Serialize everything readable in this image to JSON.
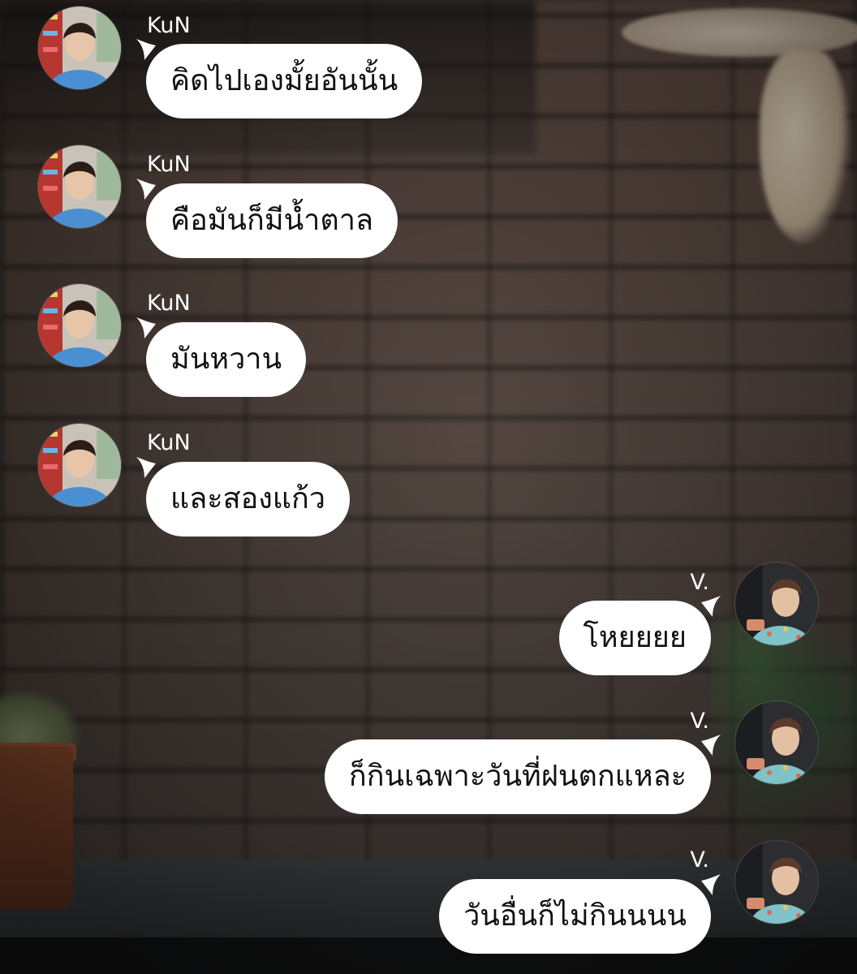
{
  "conversation": {
    "messages": [
      {
        "sender": "KuN",
        "text": "คิดไปเองมั้ยอันนั้น",
        "side": "left"
      },
      {
        "sender": "KuN",
        "text": "คือมันก็มีน้ำตาล",
        "side": "left"
      },
      {
        "sender": "KuN",
        "text": "มันหวาน",
        "side": "left"
      },
      {
        "sender": "KuN",
        "text": "และสองแก้ว",
        "side": "left"
      },
      {
        "sender": "V.",
        "text": "โหยยยย",
        "side": "right"
      },
      {
        "sender": "V.",
        "text": "ก็กินเฉพาะวันที่ฝนตกแหละ",
        "side": "right"
      },
      {
        "sender": "V.",
        "text": "วันอื่นก็ไม่กินนนน",
        "side": "right"
      }
    ]
  },
  "colors": {
    "bubble": "#ffffff",
    "text": "#111111",
    "name": "#ffffff"
  }
}
